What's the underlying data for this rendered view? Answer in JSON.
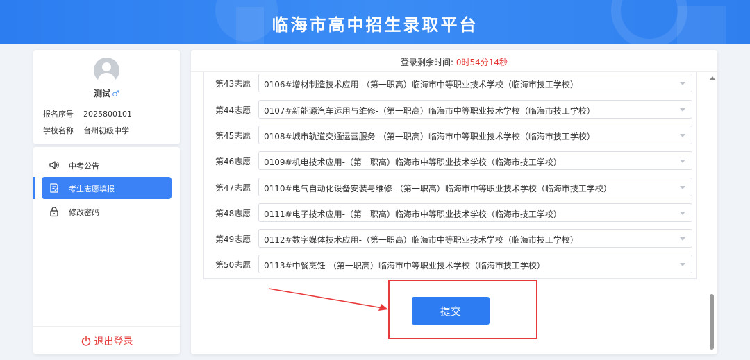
{
  "header": {
    "title": "临海市高中招生录取平台"
  },
  "profile": {
    "name": "测试",
    "gender_symbol": "♂",
    "rows": [
      {
        "key": "报名序号",
        "value": "2025800101"
      },
      {
        "key": "学校名称",
        "value": "台州初级中学"
      }
    ]
  },
  "menu": {
    "items": [
      {
        "label": "中考公告",
        "icon": "speaker-icon",
        "active": false
      },
      {
        "label": "考生志愿填报",
        "icon": "form-edit-icon",
        "active": true
      },
      {
        "label": "修改密码",
        "icon": "lock-icon",
        "active": false
      }
    ],
    "logout_label": "退出登录"
  },
  "timer": {
    "label": "登录剩余时间:",
    "value": "0时54分14秒"
  },
  "choices": [
    {
      "label": "第43志愿",
      "value": "0106#增材制造技术应用-（第一职高）临海市中等职业技术学校（临海市技工学校）"
    },
    {
      "label": "第44志愿",
      "value": "0107#新能源汽车运用与维修-（第一职高）临海市中等职业技术学校（临海市技工学校）"
    },
    {
      "label": "第45志愿",
      "value": "0108#城市轨道交通运营服务-（第一职高）临海市中等职业技术学校（临海市技工学校）"
    },
    {
      "label": "第46志愿",
      "value": "0109#机电技术应用-（第一职高）临海市中等职业技术学校（临海市技工学校）"
    },
    {
      "label": "第47志愿",
      "value": "0110#电气自动化设备安装与维修-（第一职高）临海市中等职业技术学校（临海市技工学校）"
    },
    {
      "label": "第48志愿",
      "value": "0111#电子技术应用-（第一职高）临海市中等职业技术学校（临海市技工学校）"
    },
    {
      "label": "第49志愿",
      "value": "0112#数字媒体技术应用-（第一职高）临海市中等职业技术学校（临海市技工学校）"
    },
    {
      "label": "第50志愿",
      "value": "0113#中餐烹饪-（第一职高）临海市中等职业技术学校（临海市技工学校）"
    }
  ],
  "submit_label": "提交",
  "colors": {
    "primary": "#2d7cf2",
    "timer_value": "#e53935",
    "annotation_red": "#e83a3a",
    "logout": "#e54040"
  }
}
